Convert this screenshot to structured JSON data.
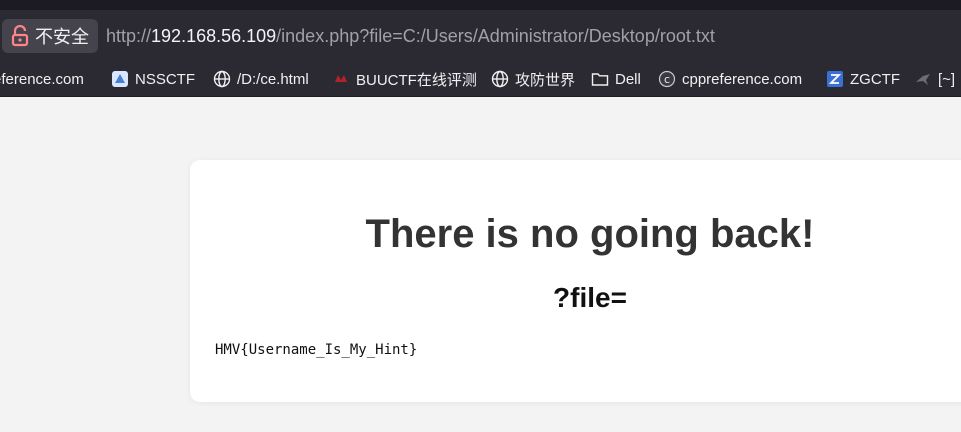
{
  "browser": {
    "security_label": "不安全",
    "url": {
      "scheme": "http://",
      "host": "192.168.56.109",
      "path": "/index.php?file=C:/Users/Administrator/Desktop/root.txt"
    },
    "bookmarks": [
      {
        "label": "eference.com",
        "icon": "cppreference-icon"
      },
      {
        "label": "NSSCTF",
        "icon": "nssctf-icon"
      },
      {
        "label": "/D:/ce.html",
        "icon": "globe-icon"
      },
      {
        "label": "BUUCTF在线评测",
        "icon": "buuctf-icon"
      },
      {
        "label": "攻防世界",
        "icon": "globe-icon"
      },
      {
        "label": "Dell",
        "icon": "folder-icon"
      },
      {
        "label": "cppreference.com",
        "icon": "cppreference-icon"
      },
      {
        "label": "ZGCTF",
        "icon": "zgctf-icon"
      },
      {
        "label": "[~]",
        "icon": "bird-icon"
      }
    ],
    "colors": {
      "chrome": "#2b2a33",
      "chip": "#45444d",
      "lock": "#ff848b"
    }
  },
  "page": {
    "heading": "There is no going back!",
    "subheading": "?file=",
    "output": "HMV{Username_Is_My_Hint}"
  }
}
